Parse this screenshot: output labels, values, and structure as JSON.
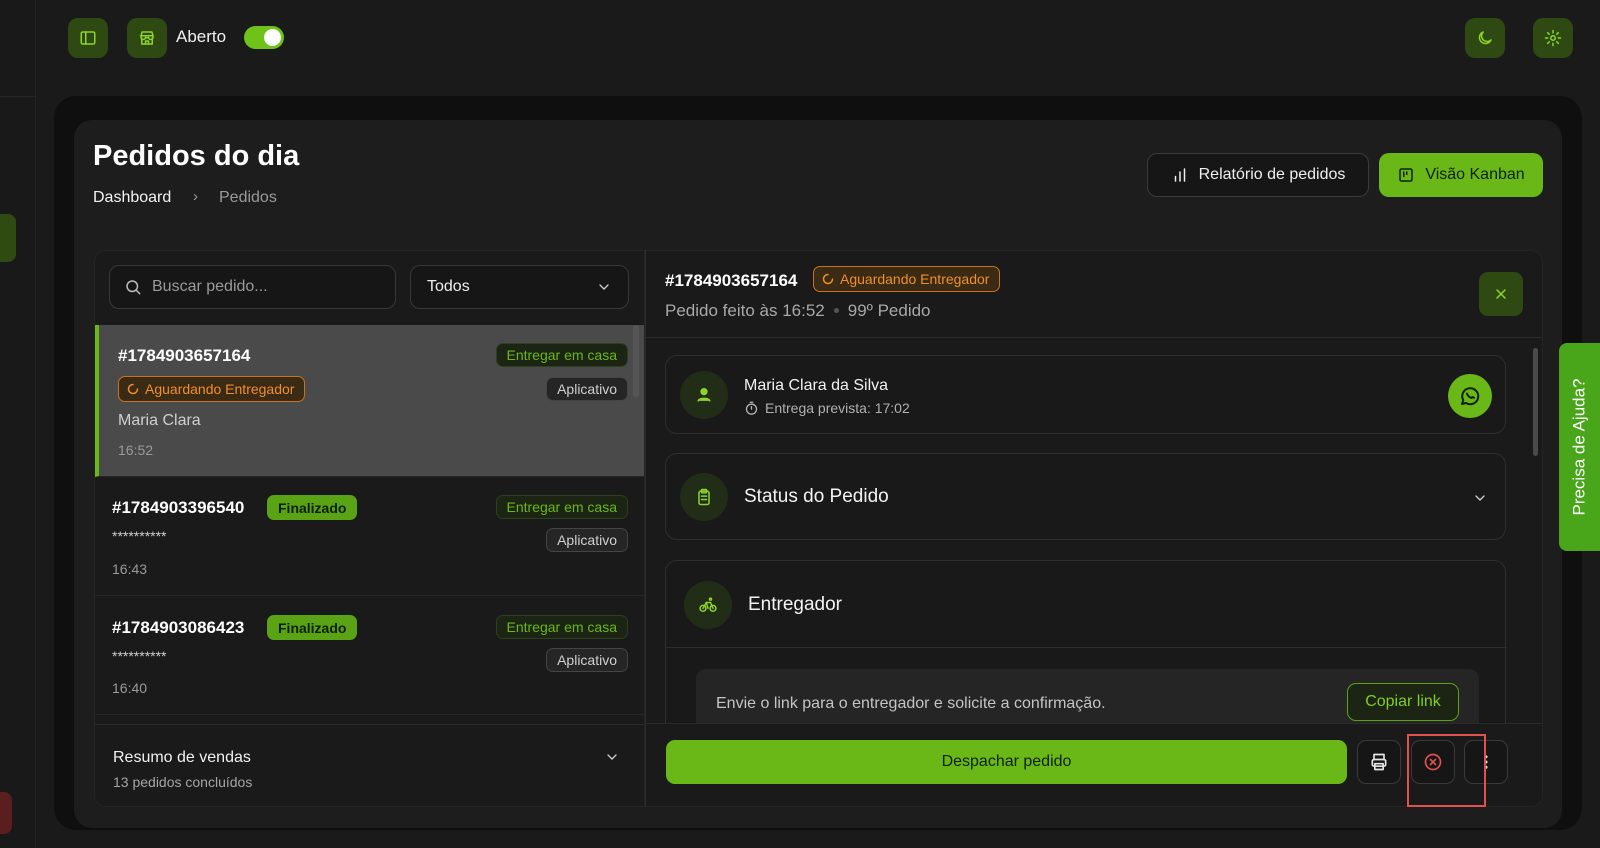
{
  "topbar": {
    "status_label": "Aberto",
    "status_on": true
  },
  "page": {
    "title": "Pedidos do dia",
    "breadcrumb": [
      "Dashboard",
      "Pedidos"
    ],
    "report_button": "Relatório de pedidos",
    "kanban_button": "Visão Kanban"
  },
  "filters": {
    "search_placeholder": "Buscar pedido...",
    "status_select": "Todos"
  },
  "orders": [
    {
      "id": "#1784903657164",
      "status": "Aguardando Entregador",
      "status_type": "waiting",
      "delivery": "Entregar em casa",
      "channel": "Aplicativo",
      "customer": "Maria Clara",
      "time": "16:52"
    },
    {
      "id": "#1784903396540",
      "status": "Finalizado",
      "status_type": "done",
      "delivery": "Entregar em casa",
      "channel": "Aplicativo",
      "customer": "**********",
      "time": "16:43"
    },
    {
      "id": "#1784903086423",
      "status": "Finalizado",
      "status_type": "done",
      "delivery": "Entregar em casa",
      "channel": "Aplicativo",
      "customer": "**********",
      "time": "16:40"
    }
  ],
  "summary": {
    "title": "Resumo de vendas",
    "subtitle": "13 pedidos concluídos"
  },
  "detail": {
    "id": "#1784903657164",
    "status": "Aguardando Entregador",
    "placed_at": "Pedido feito às 16:52",
    "order_count": "99º Pedido",
    "customer_name": "Maria Clara da Silva",
    "eta": "Entrega prevista: 17:02",
    "status_section": "Status do Pedido",
    "courier_section": "Entregador",
    "courier_text": "Envie o link para o entregador e solicite a confirmação.",
    "copy_link": "Copiar link",
    "dispatch_button": "Despachar pedido"
  },
  "help": {
    "label": "Precisa de Ajuda?"
  },
  "colors": {
    "accent": "#6ab817",
    "warning": "#f08f2e",
    "background": "#1a1a1a"
  }
}
